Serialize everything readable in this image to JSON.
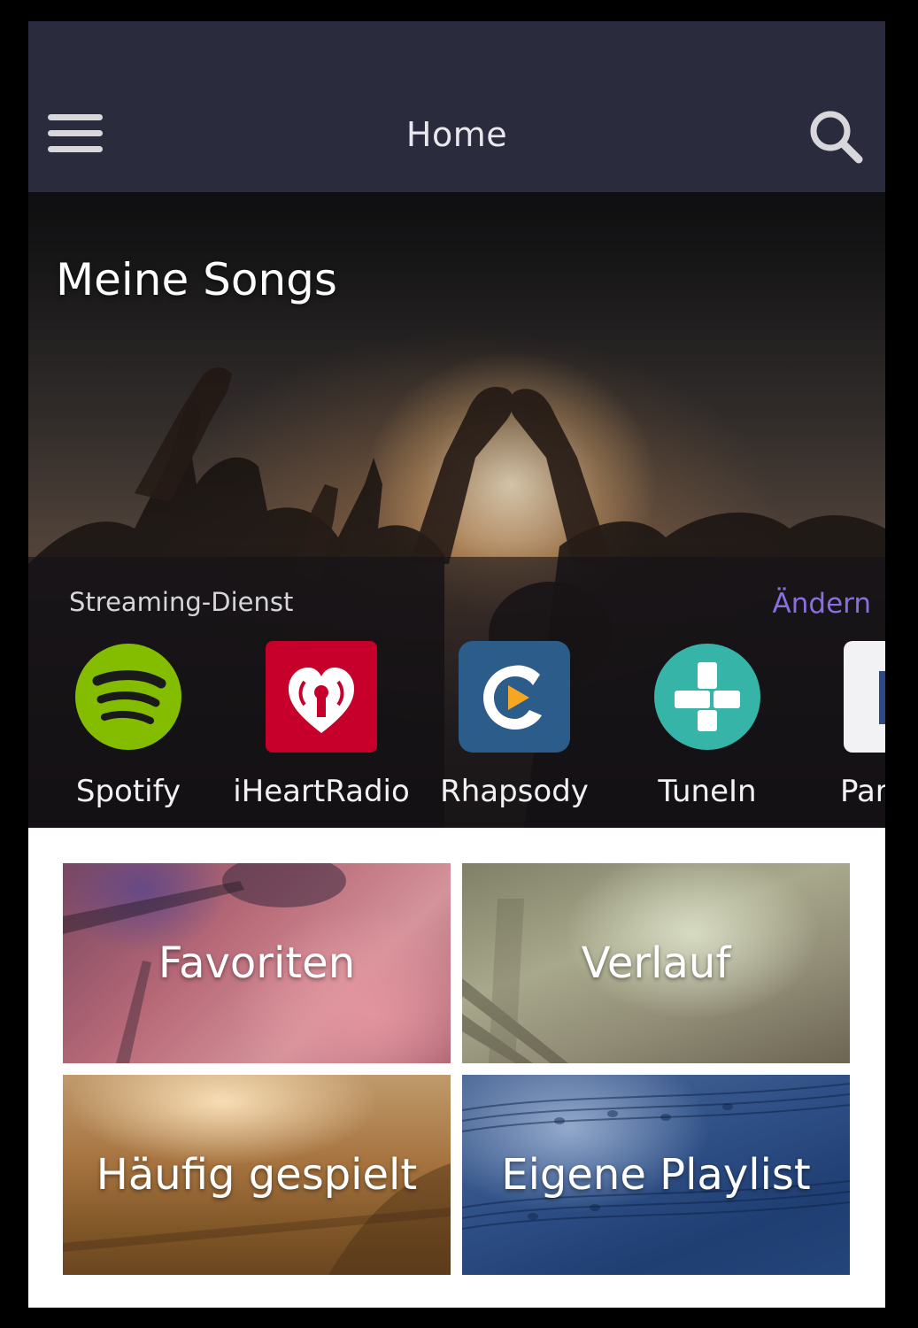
{
  "header": {
    "title": "Home",
    "menu_icon": "hamburger-menu-icon",
    "search_icon": "search-icon",
    "background": "#2a2c3e"
  },
  "hero": {
    "title": "Meine Songs",
    "streaming_label": "Streaming-Dienst",
    "change_label": "Ändern",
    "accent": "#8a6ee0"
  },
  "services": [
    {
      "name": "Spotify",
      "icon": "spotify-icon",
      "color": "#84bd00"
    },
    {
      "name": "iHeartRadio",
      "icon": "iheartradio-icon",
      "color": "#c6002b"
    },
    {
      "name": "Rhapsody",
      "icon": "rhapsody-icon",
      "color": "#2b5c8a"
    },
    {
      "name": "TuneIn",
      "icon": "tunein-icon",
      "color": "#36b4a7"
    },
    {
      "name": "Par",
      "icon": "pandora-icon",
      "color": "#f2f2f4"
    }
  ],
  "tiles": {
    "favoriten": "Favoriten",
    "verlauf": "Verlauf",
    "haufig": "Häufig gespielt",
    "playlist": "Eigene Playlist"
  }
}
